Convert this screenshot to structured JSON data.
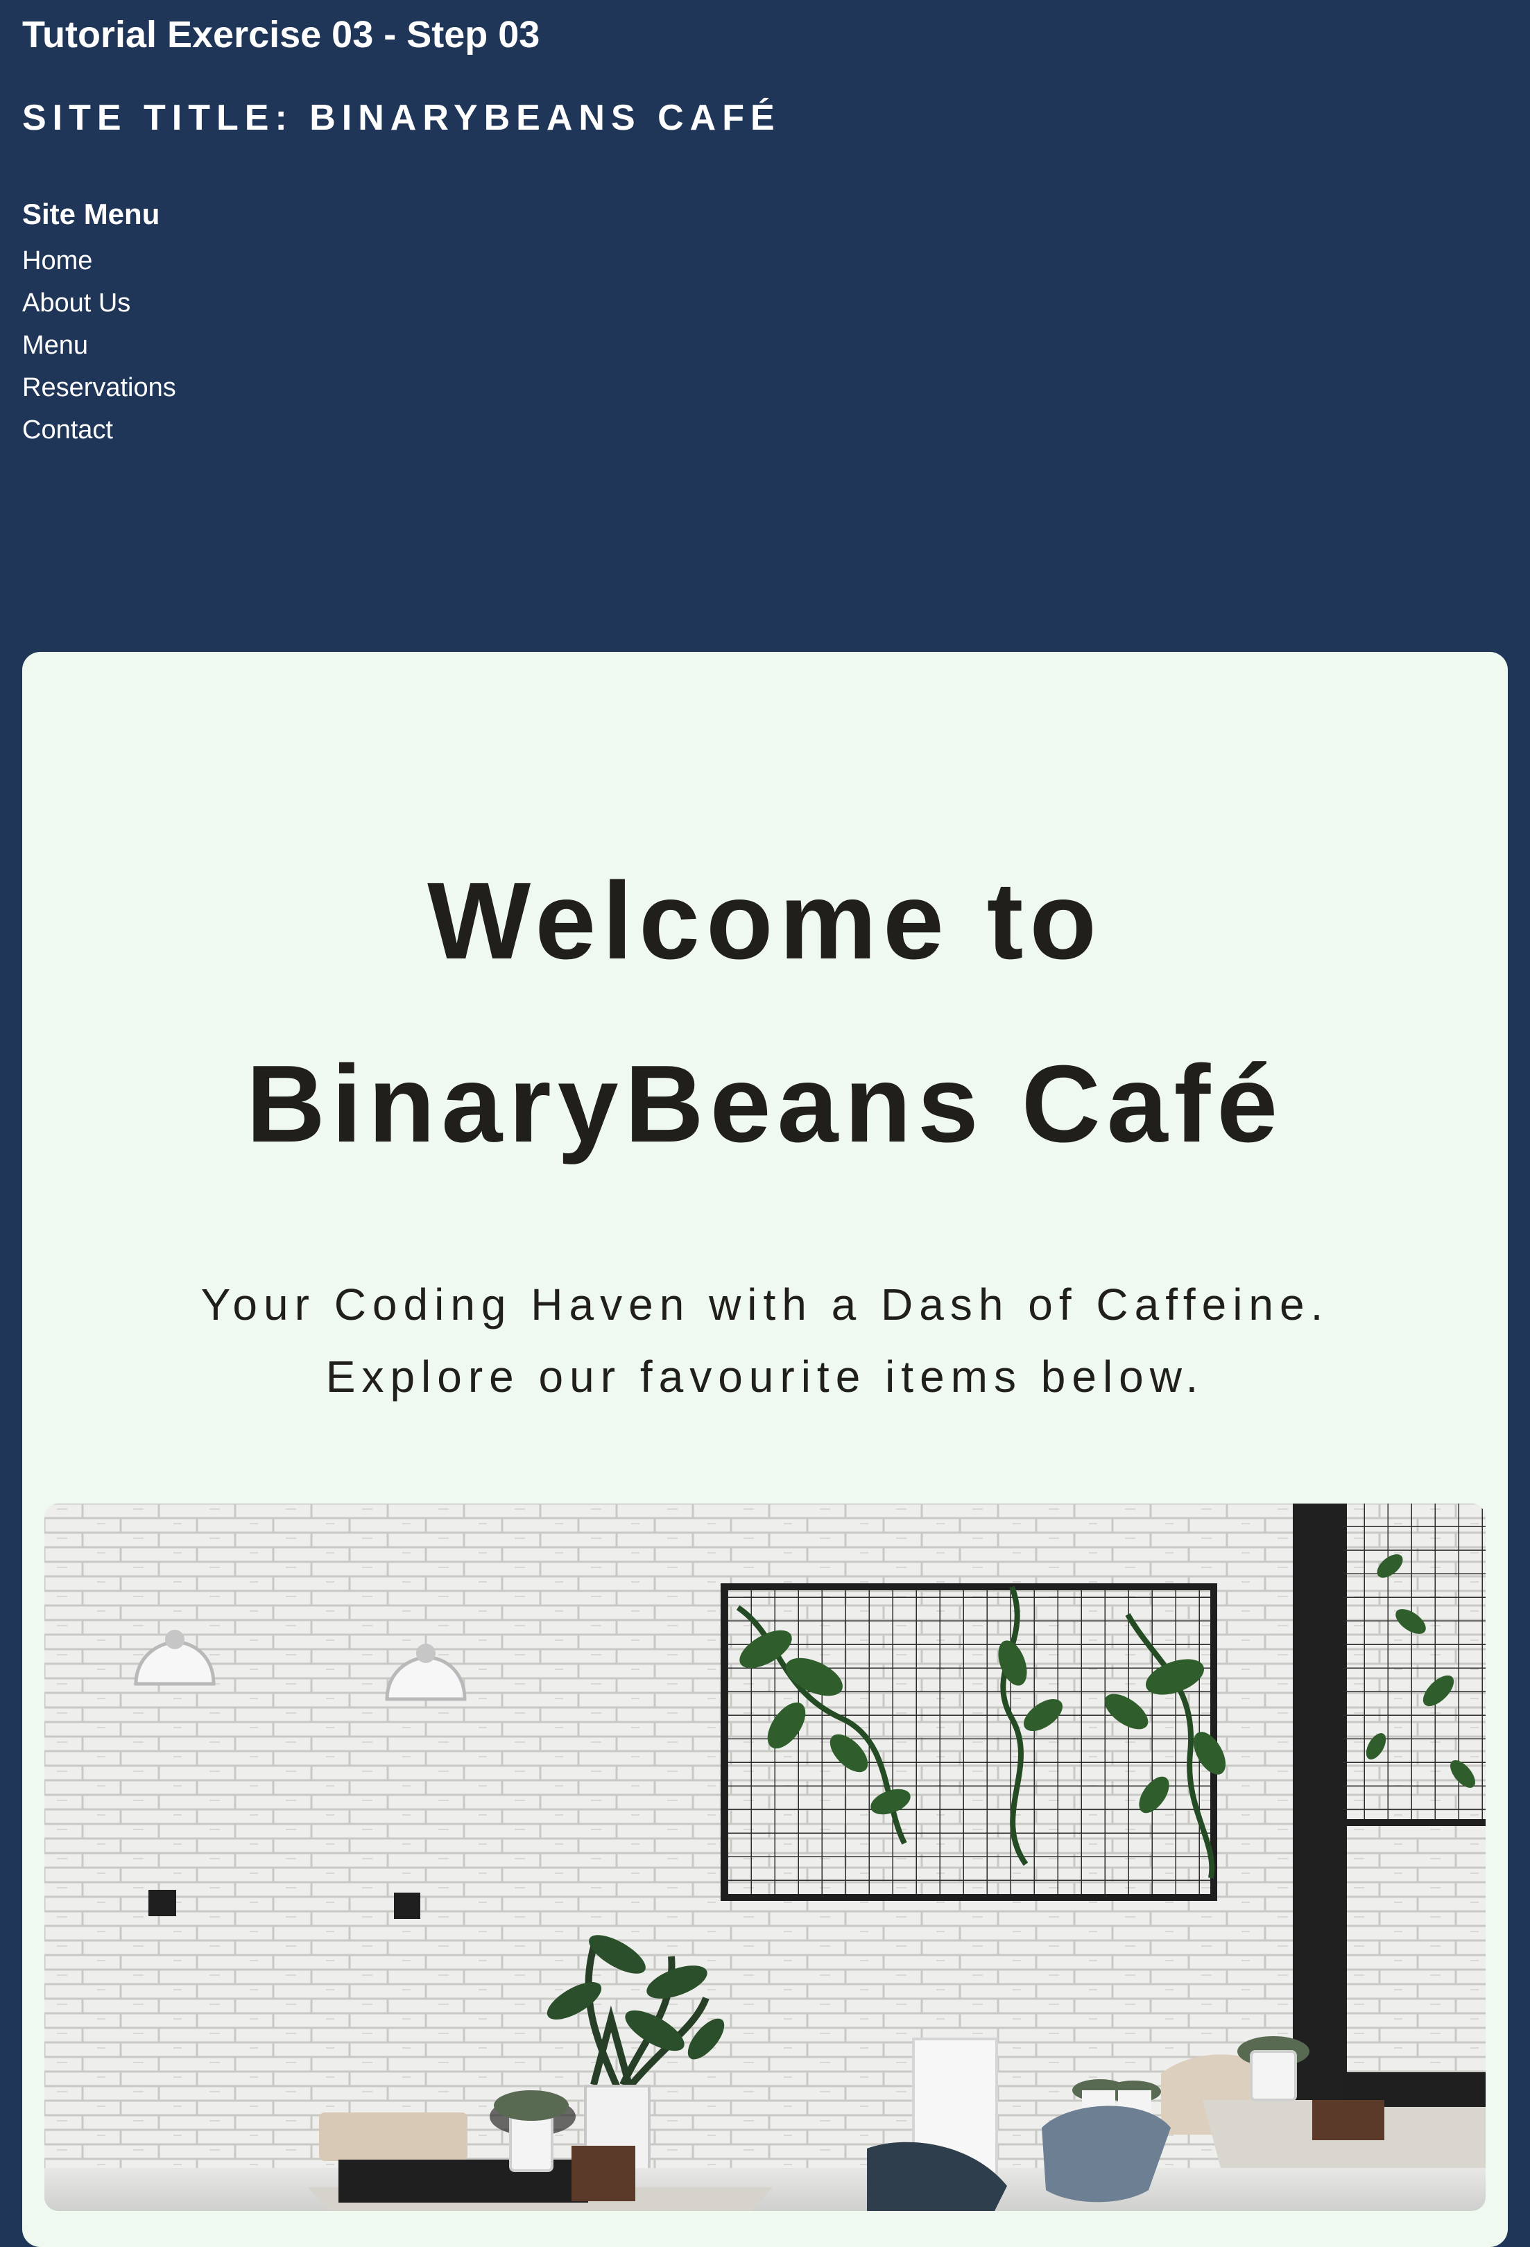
{
  "page": {
    "heading": "Tutorial Exercise 03 - Step 03",
    "site_title": "SITE TITLE: BINARYBEANS CAFÉ"
  },
  "site_menu": {
    "heading": "Site Menu",
    "items": [
      {
        "label": "Home"
      },
      {
        "label": "About Us"
      },
      {
        "label": "Menu"
      },
      {
        "label": "Reservations"
      },
      {
        "label": "Contact"
      }
    ]
  },
  "main": {
    "welcome_line1": "Welcome to",
    "welcome_line2": "BinaryBeans Café",
    "tagline_line1": "Your Coding Haven with a Dash of Caffeine.",
    "tagline_line2": "Explore our favourite items below."
  },
  "colors": {
    "page_background": "#1f3659",
    "card_background": "#eff9ef",
    "heading_text": "#211f1c",
    "menu_text": "#ffffff"
  }
}
